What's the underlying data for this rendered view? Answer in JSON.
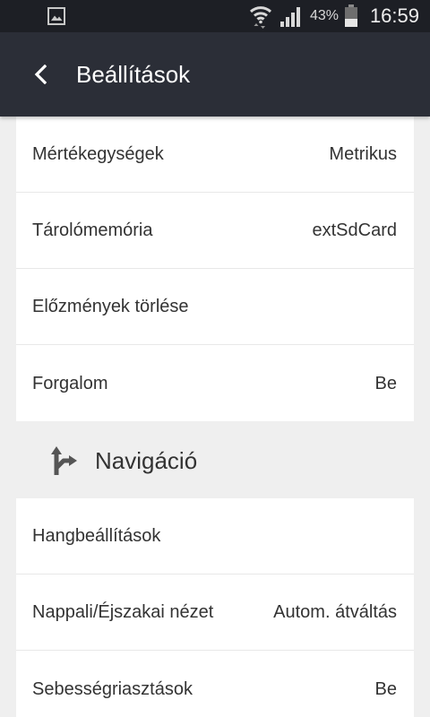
{
  "status_bar": {
    "battery_percent": "43%",
    "time": "16:59",
    "icons": {
      "notification": "gallery-icon",
      "wifi": "wifi-icon",
      "signal": "signal-icon",
      "battery": "battery-icon"
    }
  },
  "app_bar": {
    "title": "Beállítások",
    "back_icon": "back-chevron-icon"
  },
  "groups": [
    {
      "items": [
        {
          "label": "Mértékegységek",
          "value": "Metrikus"
        },
        {
          "label": "Tárolómemória",
          "value": "extSdCard"
        },
        {
          "label": "Előzmények törlése"
        },
        {
          "label": "Forgalom",
          "value": "Be"
        }
      ]
    },
    {
      "header": {
        "title": "Navigáció",
        "icon": "navigation-fork-icon"
      },
      "items": [
        {
          "label": "Hangbeállítások"
        },
        {
          "label": "Nappali/Éjszakai nézet",
          "value": "Autom. átváltás"
        },
        {
          "label": "Sebességriasztások",
          "value": "Be"
        }
      ]
    }
  ],
  "colors": {
    "status_bar_bg": "#1d1f25",
    "app_bar_bg": "#2b2e37",
    "page_bg": "#efefef",
    "card_bg": "#ffffff",
    "text": "#333333"
  }
}
